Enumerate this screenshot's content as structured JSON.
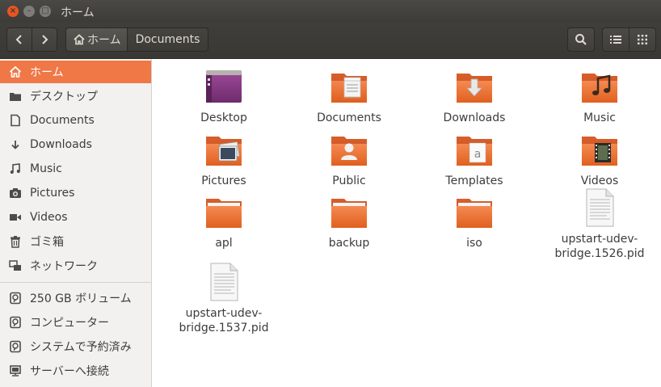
{
  "window": {
    "title": "ホーム"
  },
  "toolbar": {
    "crumb_home": "ホーム",
    "crumb_current": "Documents"
  },
  "sidebar": {
    "items": [
      {
        "label": "ホーム",
        "icon": "home-icon",
        "active": true
      },
      {
        "label": "デスクトップ",
        "icon": "desktop-icon"
      },
      {
        "label": "Documents",
        "icon": "document-icon"
      },
      {
        "label": "Downloads",
        "icon": "download-icon"
      },
      {
        "label": "Music",
        "icon": "music-icon"
      },
      {
        "label": "Pictures",
        "icon": "camera-icon"
      },
      {
        "label": "Videos",
        "icon": "video-icon"
      },
      {
        "label": "ゴミ箱",
        "icon": "trash-icon"
      },
      {
        "label": "ネットワーク",
        "icon": "network-icon"
      }
    ],
    "devices": [
      {
        "label": "250 GB ボリューム",
        "icon": "drive-icon"
      },
      {
        "label": "コンピューター",
        "icon": "computer-icon"
      },
      {
        "label": "システムで予約済み",
        "icon": "drive-icon"
      },
      {
        "label": "サーバーへ接続",
        "icon": "server-icon"
      }
    ]
  },
  "files": [
    {
      "name": "Desktop",
      "type": "desktop-folder"
    },
    {
      "name": "Documents",
      "type": "documents-folder"
    },
    {
      "name": "Downloads",
      "type": "downloads-folder"
    },
    {
      "name": "Music",
      "type": "music-folder"
    },
    {
      "name": "Pictures",
      "type": "pictures-folder"
    },
    {
      "name": "Public",
      "type": "public-folder"
    },
    {
      "name": "Templates",
      "type": "templates-folder"
    },
    {
      "name": "Videos",
      "type": "videos-folder"
    },
    {
      "name": "apl",
      "type": "folder"
    },
    {
      "name": "backup",
      "type": "folder"
    },
    {
      "name": "iso",
      "type": "folder"
    },
    {
      "name_line1": "upstart-udev-",
      "name_line2": "bridge.1526.pid",
      "type": "text-file"
    },
    {
      "name_line1": "upstart-udev-",
      "name_line2": "bridge.1537.pid",
      "type": "text-file"
    }
  ]
}
